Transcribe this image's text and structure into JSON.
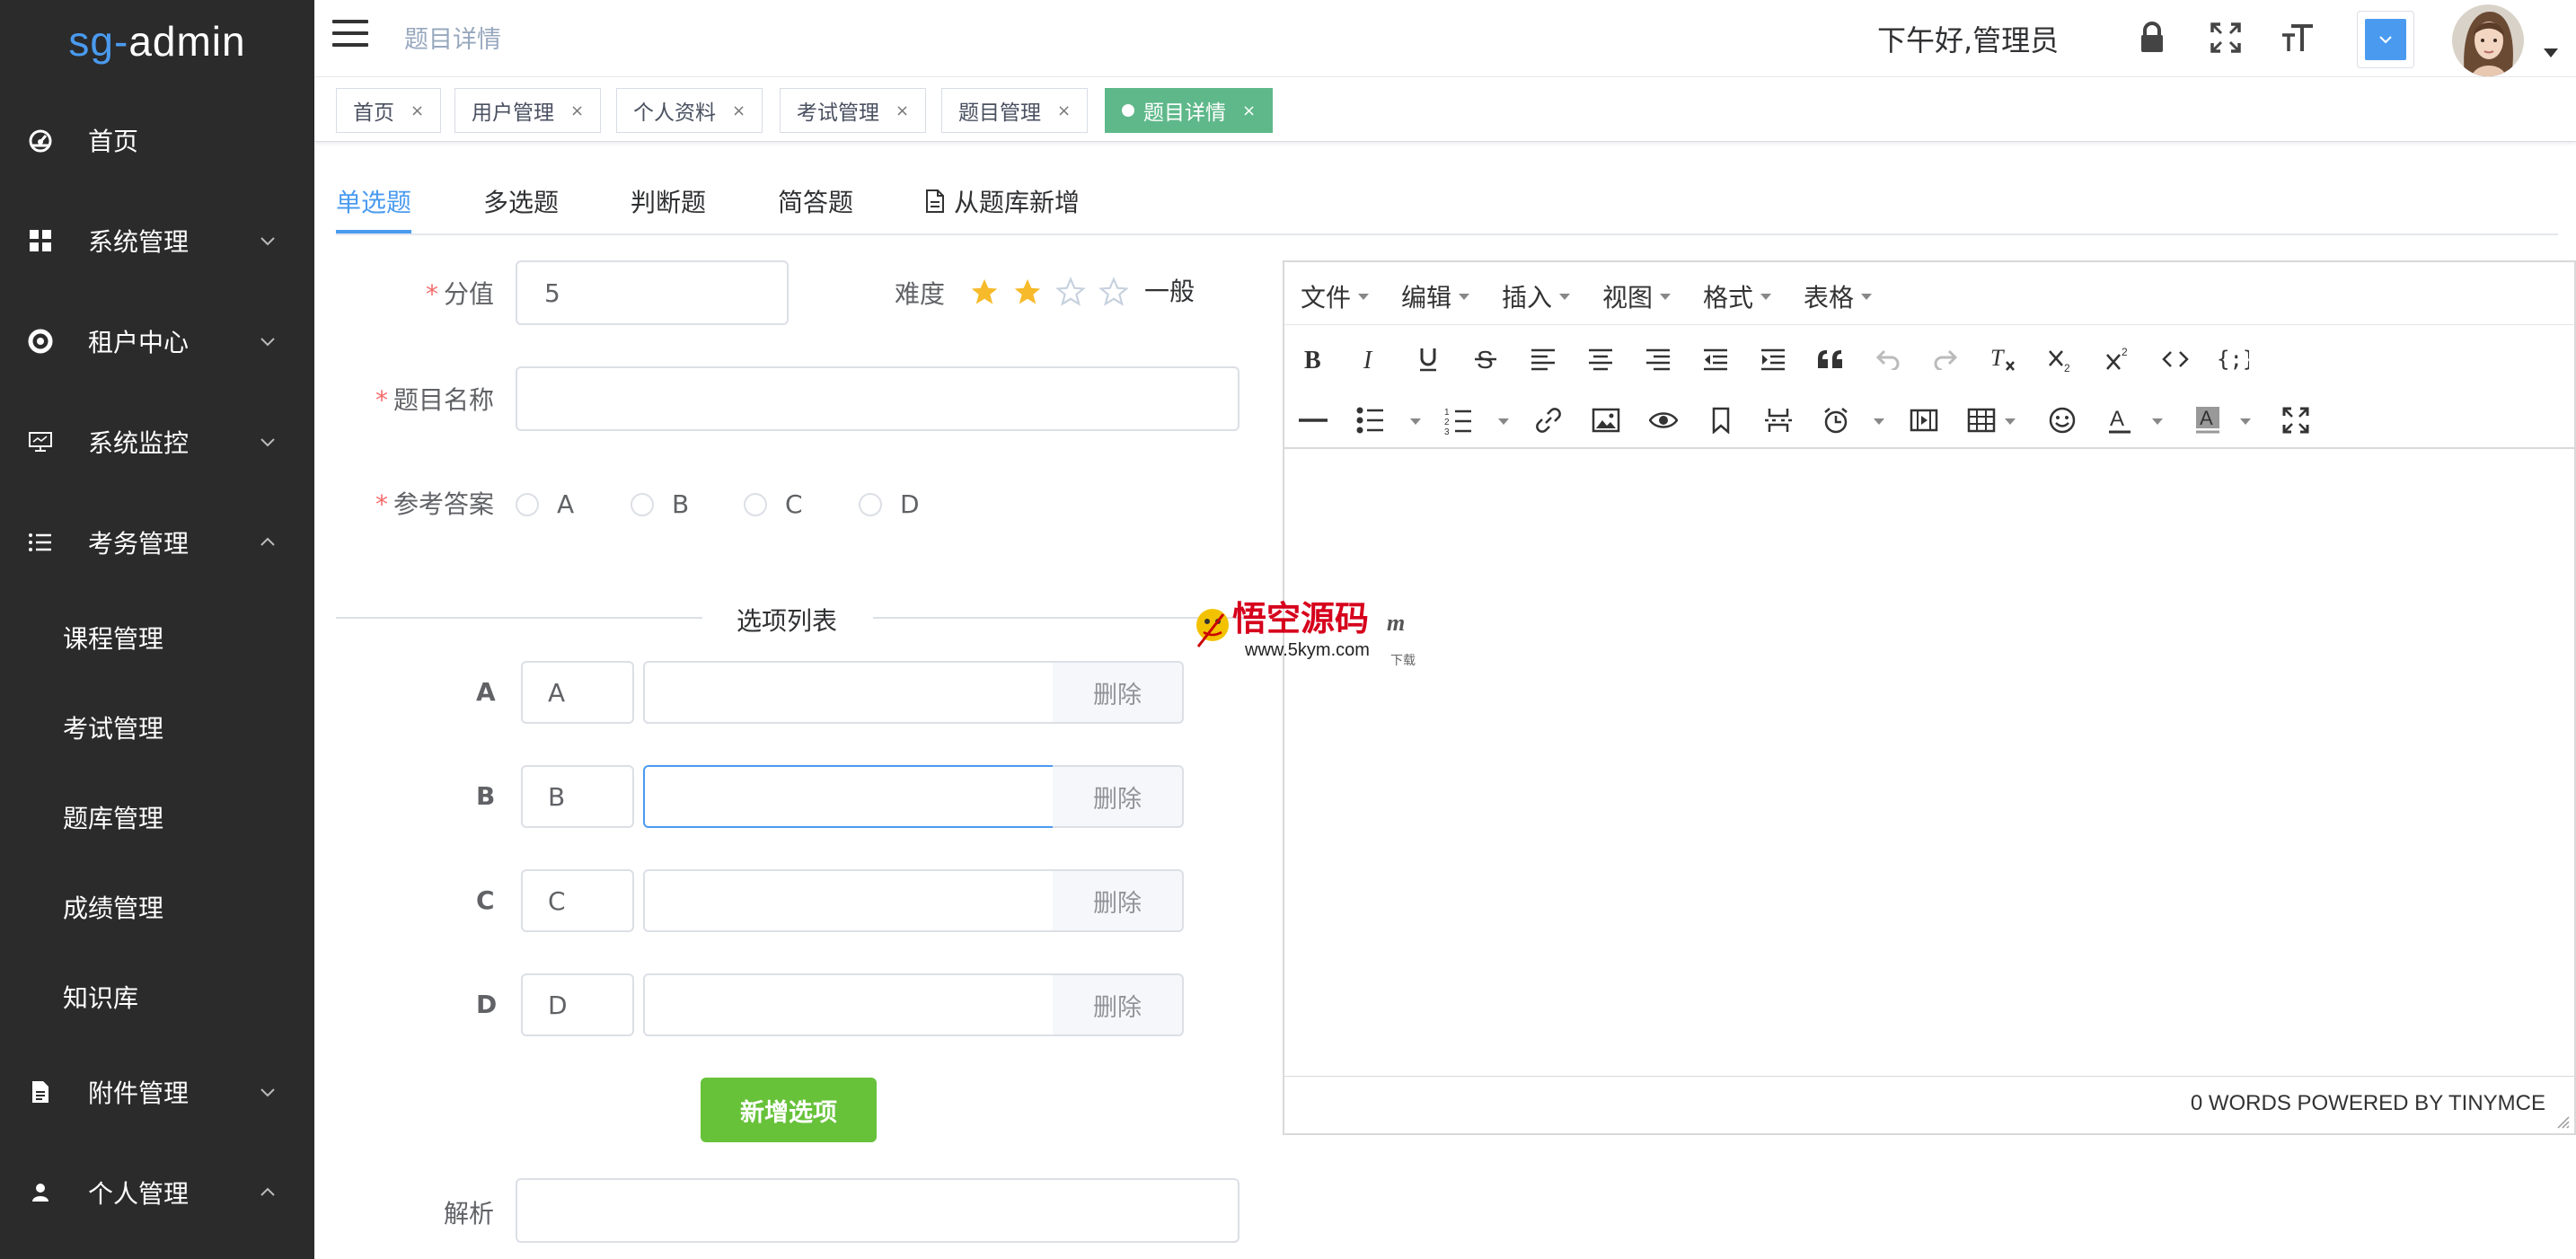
{
  "app": {
    "logo_prefix": "sg",
    "logo_sep": "-",
    "logo_suffix": "admin"
  },
  "sidebar": {
    "items": [
      {
        "label": "首页",
        "icon": "dashboard-icon"
      },
      {
        "label": "系统管理",
        "icon": "grid-icon",
        "expanded": false
      },
      {
        "label": "租户中心",
        "icon": "tenant-icon",
        "expanded": false
      },
      {
        "label": "系统监控",
        "icon": "monitor-icon",
        "expanded": false
      },
      {
        "label": "考务管理",
        "icon": "list-icon",
        "expanded": true
      },
      {
        "label": "附件管理",
        "icon": "file-icon",
        "expanded": false
      },
      {
        "label": "个人管理",
        "icon": "user-icon",
        "expanded": true
      }
    ],
    "subitems": [
      {
        "label": "课程管理"
      },
      {
        "label": "考试管理"
      },
      {
        "label": "题库管理"
      },
      {
        "label": "成绩管理"
      },
      {
        "label": "知识库"
      }
    ]
  },
  "header": {
    "breadcrumb": "题目详情",
    "greeting": "下午好,管理员"
  },
  "tags": [
    {
      "label": "首页",
      "active": false
    },
    {
      "label": "用户管理",
      "active": false
    },
    {
      "label": "个人资料",
      "active": false
    },
    {
      "label": "考试管理",
      "active": false
    },
    {
      "label": "题目管理",
      "active": false
    },
    {
      "label": "题目详情",
      "active": true
    }
  ],
  "tag_close": "×",
  "question_tabs": [
    {
      "label": "单选题",
      "active": true
    },
    {
      "label": "多选题"
    },
    {
      "label": "判断题"
    },
    {
      "label": "简答题"
    },
    {
      "label": "从题库新增"
    }
  ],
  "form": {
    "score_label": "分值",
    "score_value": "5",
    "difficulty_label": "难度",
    "difficulty_rating": 2,
    "difficulty_max": 5,
    "difficulty_text": "一般",
    "name_label": "题目名称",
    "answer_label": "参考答案",
    "answer_options": [
      "A",
      "B",
      "C",
      "D"
    ],
    "options_divider": "选项列表",
    "options": [
      {
        "label": "A",
        "key": "A",
        "value": ""
      },
      {
        "label": "B",
        "key": "B",
        "value": ""
      },
      {
        "label": "C",
        "key": "C",
        "value": ""
      },
      {
        "label": "D",
        "key": "D",
        "value": ""
      }
    ],
    "delete_label": "删除",
    "add_option_label": "新增选项",
    "analysis_label": "解析"
  },
  "editor": {
    "menus": [
      "文件",
      "编辑",
      "插入",
      "视图",
      "格式",
      "表格"
    ],
    "status": "0 WORDS POWERED BY TINYMCE"
  },
  "colors": {
    "sidebar_bg": "#2b2b2c",
    "accent": "#4a9bf0",
    "active_tag": "#5eb88a",
    "add_button": "#67c23a",
    "star": "#f7ba2a",
    "required": "#f56c6c"
  }
}
